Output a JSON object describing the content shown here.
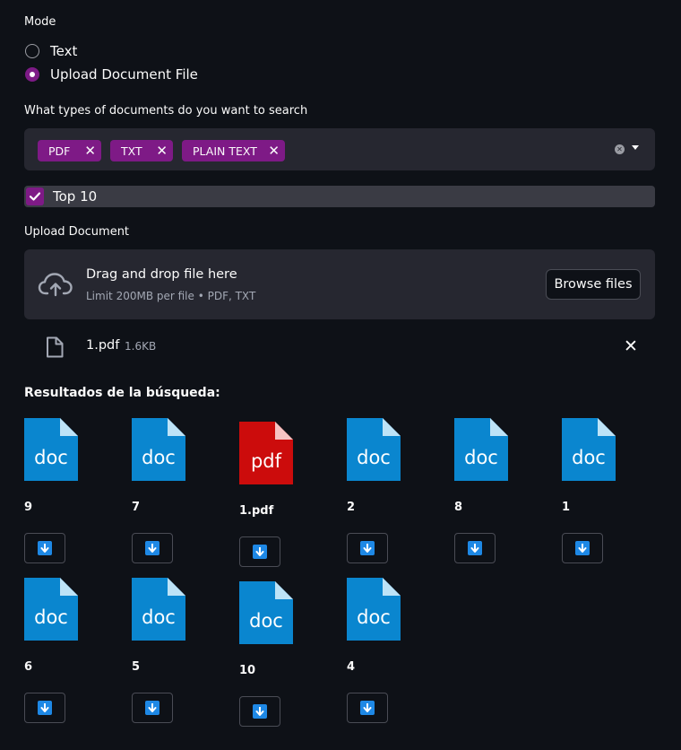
{
  "mode": {
    "label": "Mode",
    "options": [
      {
        "label": "Text",
        "selected": false
      },
      {
        "label": "Upload Document File",
        "selected": true
      }
    ]
  },
  "doc_types": {
    "label": "What types of documents do you want to search",
    "chips": [
      "PDF",
      "TXT",
      "PLAIN TEXT"
    ]
  },
  "top10": {
    "label": "Top 10",
    "checked": true
  },
  "upload": {
    "label": "Upload Document",
    "drag_text": "Drag and drop file here",
    "limit_text": "Limit 200MB per file • PDF, TXT",
    "browse_label": "Browse files",
    "file": {
      "name": "1.pdf",
      "size": "1.6KB"
    }
  },
  "results": {
    "heading": "Resultados de la búsqueda:",
    "items": [
      {
        "name": "9",
        "kind": "doc"
      },
      {
        "name": "7",
        "kind": "doc"
      },
      {
        "name": "1.pdf",
        "kind": "pdf"
      },
      {
        "name": "2",
        "kind": "doc"
      },
      {
        "name": "8",
        "kind": "doc"
      },
      {
        "name": "1",
        "kind": "doc"
      },
      {
        "name": "6",
        "kind": "doc"
      },
      {
        "name": "5",
        "kind": "doc"
      },
      {
        "name": "10",
        "kind": "doc"
      },
      {
        "name": "4",
        "kind": "doc"
      }
    ]
  },
  "colors": {
    "accent": "#7e1a86",
    "doc_blue": "#0a86cf",
    "pdf_red": "#cc0c0c",
    "background": "#0e1117",
    "panel": "#262730"
  },
  "icons": {
    "file_icon": "page-icon",
    "upload_icon": "cloud-upload-icon",
    "download_icon": "download-arrow-icon"
  }
}
